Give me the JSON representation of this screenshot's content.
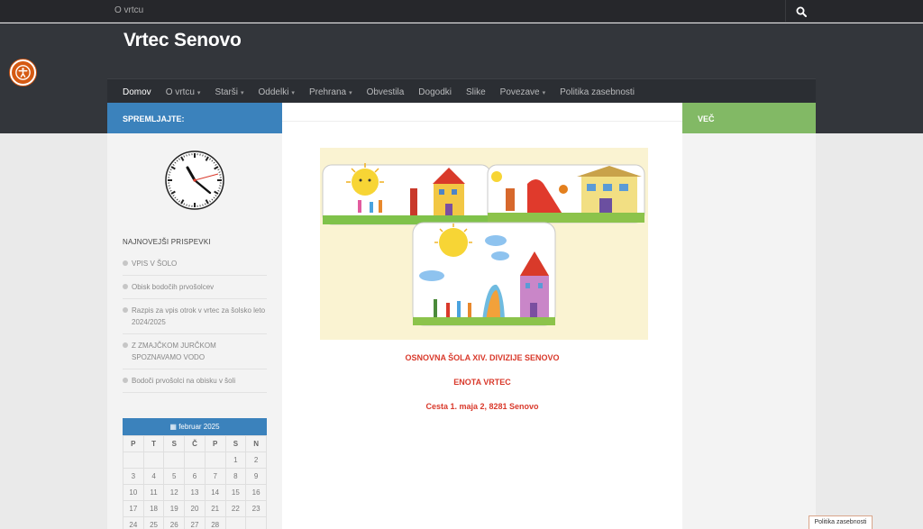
{
  "topbar": {
    "link": "O vrtcu",
    "search_icon": "search-icon"
  },
  "header": {
    "title": "Vrtec Senovo",
    "accessibility_icon": "accessibility-icon"
  },
  "nav": {
    "items": [
      {
        "label": "Domov",
        "has_caret": false
      },
      {
        "label": "O vrtcu",
        "has_caret": true
      },
      {
        "label": "Starši",
        "has_caret": true
      },
      {
        "label": "Oddelki",
        "has_caret": true
      },
      {
        "label": "Prehrana",
        "has_caret": true
      },
      {
        "label": "Obvestila",
        "has_caret": false
      },
      {
        "label": "Dogodki",
        "has_caret": false
      },
      {
        "label": "Slike",
        "has_caret": false
      },
      {
        "label": "Povezave",
        "has_caret": true
      },
      {
        "label": "Politika zasebnosti",
        "has_caret": false
      }
    ],
    "caret": "▾"
  },
  "left": {
    "heading": "SPREMLJAJTE:",
    "recent_title": "NAJNOVEJŠI PRISPEVKI",
    "posts": [
      "VPIS V ŠOLO",
      "Obisk bodočih prvošolcev",
      "Razpis za vpis otrok v vrtec za šolsko leto 2024/2025",
      "Z ZMAJČKOM JURČKOM SPOZNAVAMO VODO",
      "Bodoči prvošolci na obisku v šoli"
    ],
    "calendar": {
      "month": "februar 2025",
      "days": [
        "P",
        "T",
        "S",
        "Č",
        "P",
        "S",
        "N"
      ],
      "weeks": [
        [
          "",
          "",
          "",
          "",
          "",
          "1",
          "2"
        ],
        [
          "3",
          "4",
          "5",
          "6",
          "7",
          "8",
          "9"
        ],
        [
          "10",
          "11",
          "12",
          "13",
          "14",
          "15",
          "16"
        ],
        [
          "17",
          "18",
          "19",
          "20",
          "21",
          "22",
          "23"
        ],
        [
          "24",
          "25",
          "26",
          "27",
          "28",
          "",
          ""
        ]
      ]
    }
  },
  "right": {
    "heading": "VEČ"
  },
  "main": {
    "line1": "OSNOVNA ŠOLA XIV. DIVIZIJE SENOVO",
    "line2": "ENOTA VRTEC",
    "line3": "Cesta 1. maja 2, 8281 Senovo"
  },
  "footer": {
    "privacy_badge": "Politika zasebnosti"
  },
  "colors": {
    "accent_blue": "#3b82bc",
    "accent_green": "#82b965",
    "accent_red": "#d9392b",
    "header_bg": "#33363b"
  }
}
